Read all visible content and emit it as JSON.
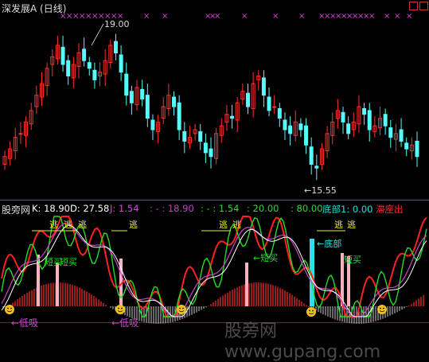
{
  "top_panel": {
    "title": "深发展A (日线)",
    "high_label": "19.00",
    "low_label": "←15.55"
  },
  "indicator_panel": {
    "name": "股旁网",
    "readouts": [
      {
        "label": "K: 18.90",
        "color": "#ffffff"
      },
      {
        "label": "D: 27.58",
        "color": "#ffffff"
      },
      {
        "label": "J: 1.54",
        "color": "#e040e0"
      },
      {
        "label": ": - : 18.90",
        "color": "#c040c0"
      },
      {
        "label": ": - : 1.54",
        "color": "#2fd82f"
      },
      {
        "label": ": 20.00",
        "color": "#2fd82f"
      },
      {
        "label": ": 80.00",
        "color": "#2fd82f"
      },
      {
        "label": "底部1: 0.00",
        "color": "#20e0e0"
      },
      {
        "label": "滞座出",
        "color": "#ff3030"
      }
    ],
    "signal_labels": {
      "escape": "逃",
      "short_buy": "短买",
      "bottom": "底部",
      "low_suck": "←低吸",
      "short_buy_arrow": "短买"
    }
  },
  "watermark": "股旁网 www.gupang.com",
  "colors": {
    "up": "#ff3030",
    "down": "#54fcfc",
    "k": "#ffffff",
    "d": "#ff2020",
    "j": "#22dd22",
    "mid": "#cc44cc",
    "cross": "#e040e0",
    "bar_pos": "#ff3030",
    "bar_neg": "#cccccc",
    "bottom_bar": "#30e0e8",
    "pink_bar": "#ffb0c0",
    "yellow": "#f0f020"
  },
  "chart_data": {
    "type": "candlestick",
    "title": "深发展A (日线)",
    "ylim": [
      15,
      19.5
    ],
    "annotations": [
      {
        "text": "19.00",
        "value": 19.0
      },
      {
        "text": "15.55",
        "value": 15.55
      }
    ],
    "candles_close": [
      16.0,
      16.2,
      16.5,
      16.6,
      16.9,
      17.2,
      17.6,
      17.9,
      18.3,
      18.6,
      18.9,
      18.4,
      18.1,
      18.4,
      18.7,
      18.5,
      18.3,
      18.0,
      18.2,
      18.5,
      18.9,
      18.7,
      18.2,
      17.6,
      17.4,
      17.8,
      17.5,
      17.0,
      16.7,
      16.9,
      17.3,
      17.6,
      17.3,
      16.7,
      16.4,
      16.5,
      16.7,
      16.4,
      16.1,
      16.0,
      16.6,
      16.8,
      17.1,
      17.0,
      17.4,
      17.7,
      17.3,
      17.9,
      18.1,
      17.6,
      17.2,
      17.3,
      17.0,
      16.7,
      16.6,
      16.9,
      16.7,
      16.3,
      15.8,
      15.7,
      16.2,
      16.6,
      16.9,
      17.2,
      16.9,
      16.6,
      16.9,
      17.3,
      17.1,
      16.7,
      16.8,
      17.0,
      16.8,
      16.5,
      16.6,
      16.4,
      16.2,
      16.3,
      16.0
    ],
    "cross_markers_count": 45,
    "indicator": {
      "K_last": 18.9,
      "D_last": 27.58,
      "J_last": 1.54,
      "levels": [
        20.0,
        80.0
      ],
      "bottom1": 0.0
    }
  }
}
